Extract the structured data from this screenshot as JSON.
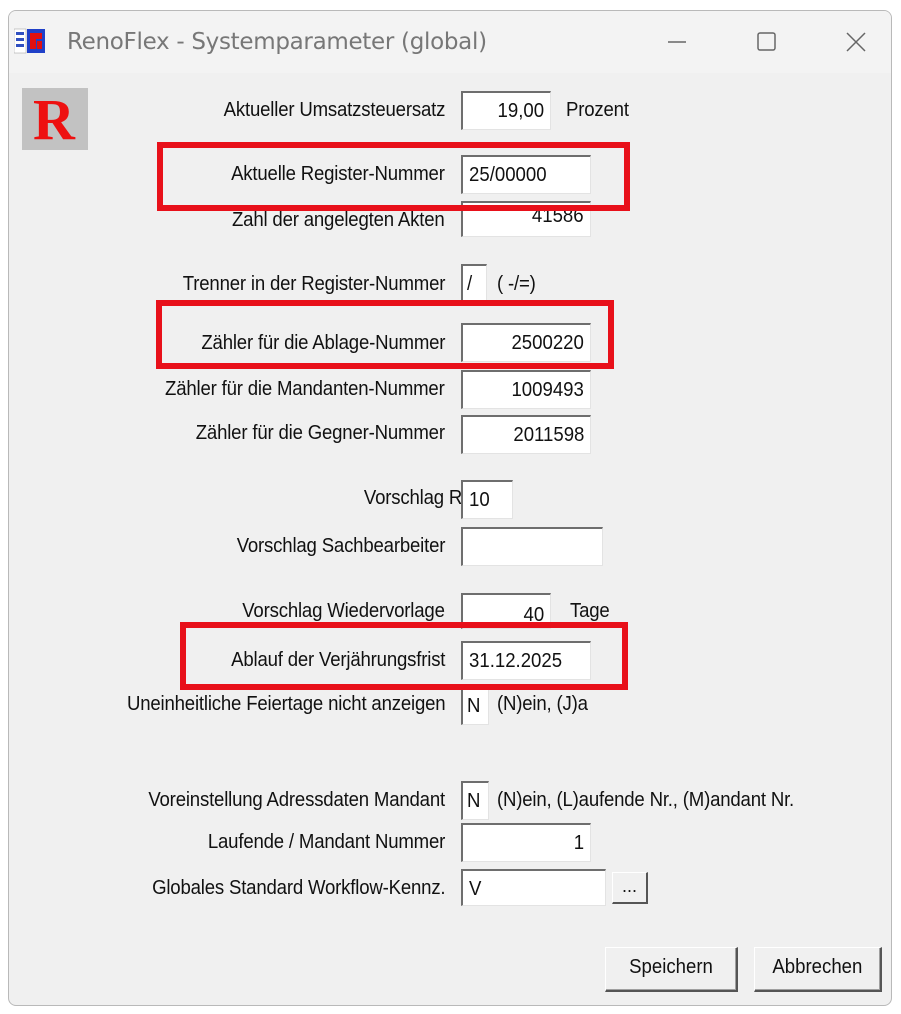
{
  "window": {
    "title": "RenoFlex - Systemparameter (global)",
    "minimize_glyph": "—",
    "maximize_glyph": "☐",
    "close_glyph": "✕"
  },
  "logo": {
    "letter": "R",
    "color": "#ee1010"
  },
  "fields": {
    "ust": {
      "label": "Aktueller Umsatzsteuersatz",
      "value": "19,00",
      "suffix": "Prozent"
    },
    "register_nummer": {
      "label": "Aktuelle Register-Nummer",
      "value": "25/00000"
    },
    "akten": {
      "label": "Zahl der angelegten Akten",
      "value": "41586"
    },
    "trenner": {
      "label": "Trenner in der Register-Nummer",
      "value": "/",
      "suffix": "( -/=)"
    },
    "ablage": {
      "label": "Zähler für die Ablage-Nummer",
      "value": "2500220"
    },
    "mandanten": {
      "label": "Zähler für die Mandanten-Nummer",
      "value": "1009493"
    },
    "gegner": {
      "label": "Zähler für die Gegner-Nummer",
      "value": "2011598"
    },
    "referat": {
      "label": "Vorschlag Referat",
      "value": "10"
    },
    "sachbearbeiter": {
      "label": "Vorschlag Sachbearbeiter",
      "value": ""
    },
    "wiedervorlage": {
      "label": "Vorschlag Wiedervorlage",
      "value": "40",
      "suffix": "Tage"
    },
    "verjaehrung": {
      "label": "Ablauf der Verjährungsfrist",
      "value": "31.12.2025"
    },
    "feiertage": {
      "label": "Uneinheitliche Feiertage nicht anzeigen",
      "value": "N",
      "suffix": "(N)ein, (J)a"
    },
    "adressdaten": {
      "label": "Voreinstellung Adressdaten Mandant",
      "value": "N",
      "suffix": "(N)ein, (L)aufende Nr., (M)andant Nr."
    },
    "laufende": {
      "label": "Laufende / Mandant Nummer",
      "value": "1"
    },
    "workflow": {
      "label": "Globales Standard Workflow-Kennz.",
      "value": "V",
      "browse": "..."
    }
  },
  "buttons": {
    "save": "Speichern",
    "cancel": "Abbrechen"
  },
  "highlight_color": "#e8101a"
}
